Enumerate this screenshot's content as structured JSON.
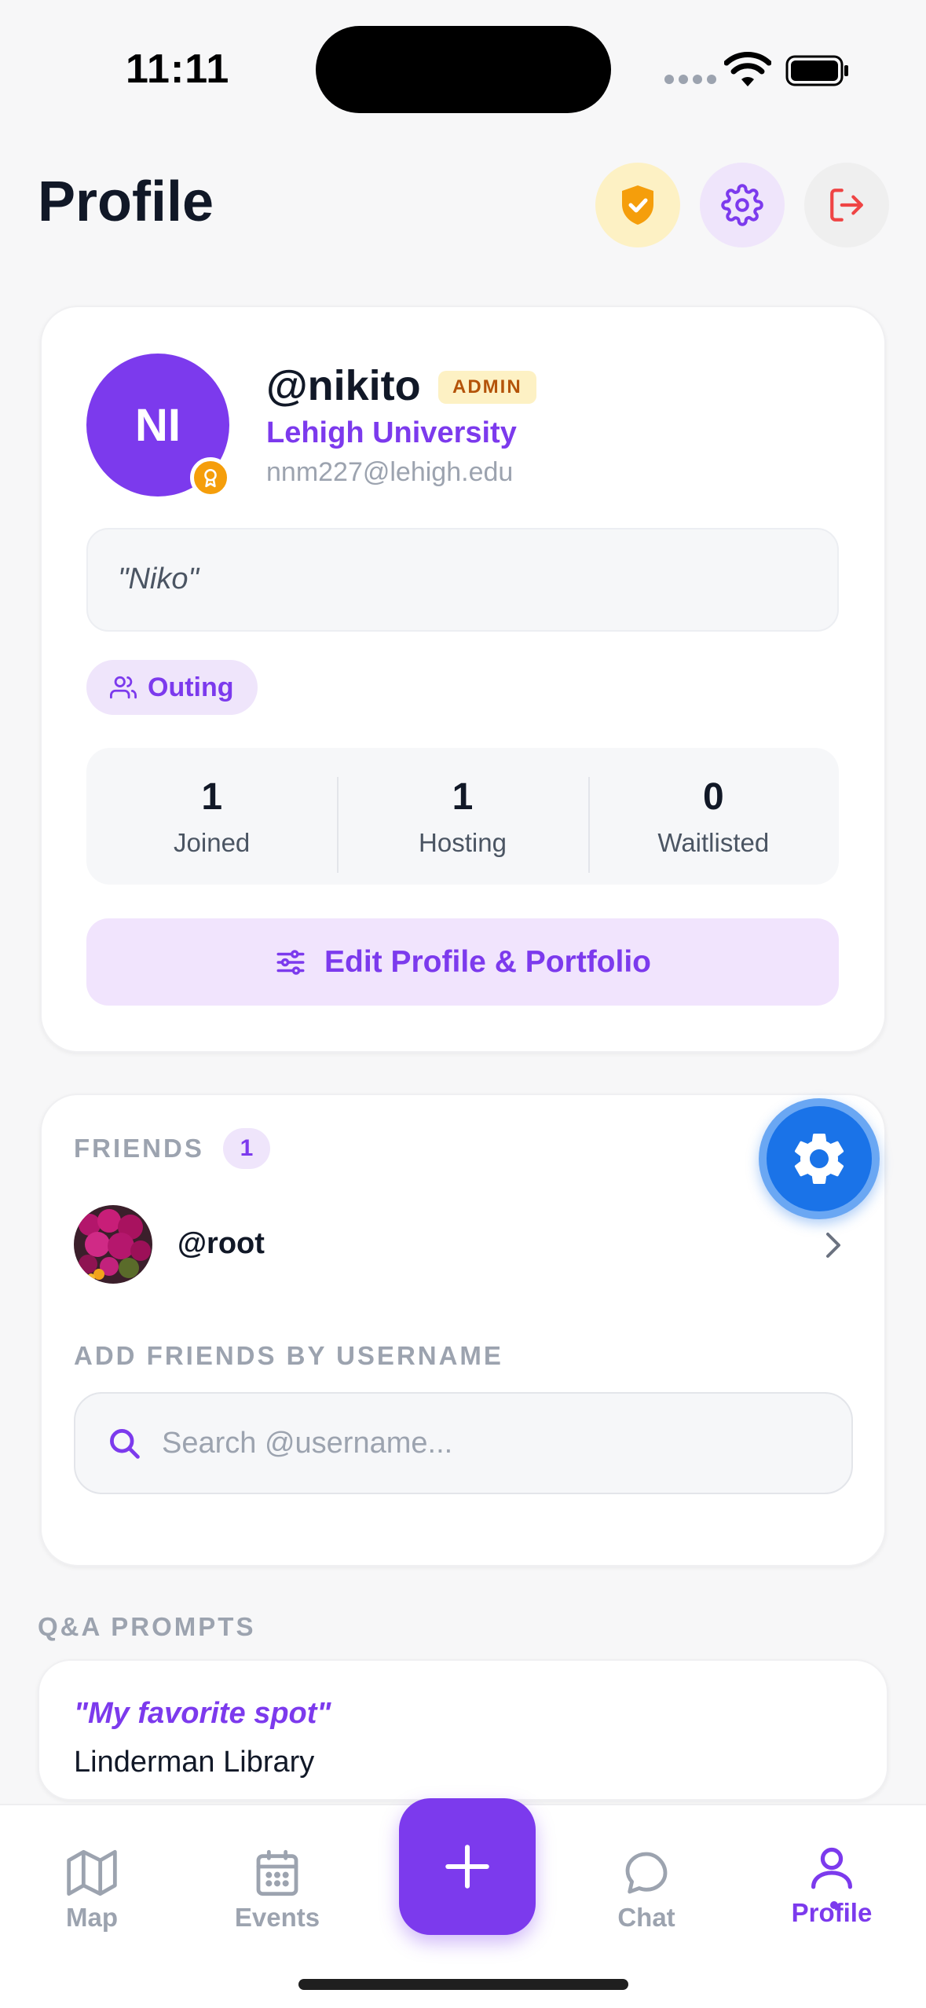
{
  "status_bar": {
    "time": "11:11"
  },
  "header": {
    "title": "Profile"
  },
  "profile": {
    "initials": "NI",
    "username": "@nikito",
    "role_badge": "ADMIN",
    "university": "Lehigh University",
    "email": "nnm227@lehigh.edu",
    "bio_quote": "\"Niko\"",
    "tag": "Outing",
    "stats": [
      {
        "value": "1",
        "label": "Joined"
      },
      {
        "value": "1",
        "label": "Hosting"
      },
      {
        "value": "0",
        "label": "Waitlisted"
      }
    ],
    "edit_button": "Edit Profile & Portfolio"
  },
  "friends": {
    "label": "FRIENDS",
    "count": "1",
    "items": [
      {
        "username": "@root"
      }
    ],
    "add_label": "ADD FRIENDS BY USERNAME",
    "search_placeholder": "Search @username...",
    "search_value": ""
  },
  "qa": {
    "label": "Q&A PROMPTS",
    "items": [
      {
        "question": "\"My favorite spot\"",
        "answer": "Linderman Library"
      }
    ]
  },
  "tabbar": {
    "tabs": [
      {
        "label": "Map",
        "icon": "map-icon"
      },
      {
        "label": "Events",
        "icon": "calendar-icon"
      },
      {
        "label": "Chat",
        "icon": "chat-icon"
      },
      {
        "label": "Profile",
        "icon": "user-icon"
      }
    ],
    "active": "Profile"
  },
  "colors": {
    "accent": "#7c3aed",
    "admin_badge_bg": "#fdf1c4",
    "admin_badge_text": "#b45309",
    "floating_gear": "#1a73e8",
    "logout": "#ef4444"
  }
}
